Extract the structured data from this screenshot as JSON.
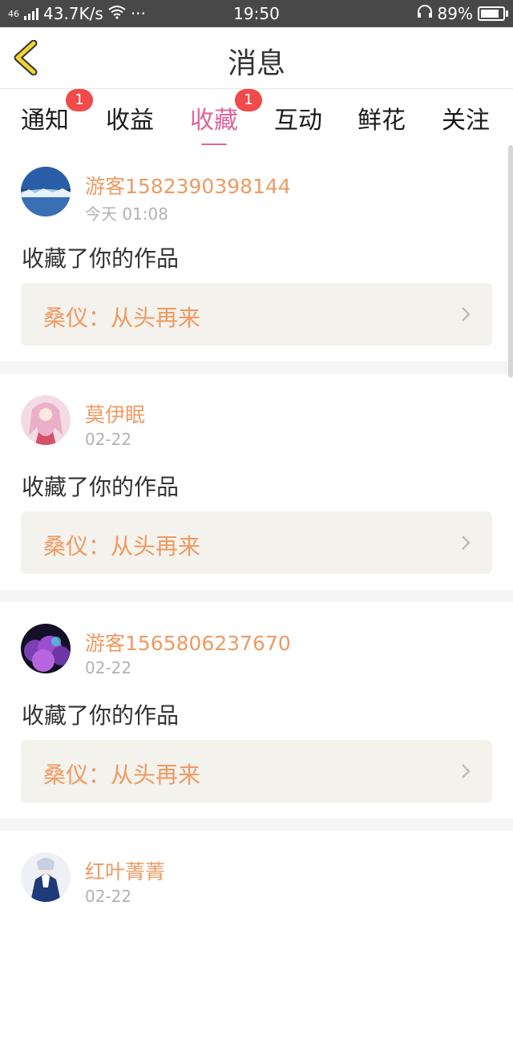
{
  "status_bar": {
    "network": "46",
    "speed": "43.7K/s",
    "more": "···",
    "time": "19:50",
    "battery": "89%"
  },
  "header": {
    "title": "消息"
  },
  "tabs": [
    {
      "label": "通知",
      "badge": "1"
    },
    {
      "label": "收益"
    },
    {
      "label": "收藏",
      "badge": "1",
      "active": true
    },
    {
      "label": "互动"
    },
    {
      "label": "鲜花"
    },
    {
      "label": "关注"
    }
  ],
  "messages": [
    {
      "user": "游客1582390398144",
      "time": "今天 01:08",
      "action": "收藏了你的作品",
      "work": "桑仪：从头再来",
      "avatar_icon": "snow-landscape-avatar"
    },
    {
      "user": "莫伊眠",
      "time": "02-22",
      "action": "收藏了你的作品",
      "work": "桑仪：从头再来",
      "avatar_icon": "anime-girl-avatar"
    },
    {
      "user": "游客1565806237670",
      "time": "02-22",
      "action": "收藏了你的作品",
      "work": "桑仪：从头再来",
      "avatar_icon": "purple-clouds-avatar"
    },
    {
      "user": "红叶菁菁",
      "time": "02-22",
      "avatar_icon": "anime-character-avatar"
    }
  ],
  "colors": {
    "accent": "#e0639a",
    "username": "#ee9a62",
    "badge": "#f04a4a",
    "back_arrow": "#f2d330"
  }
}
